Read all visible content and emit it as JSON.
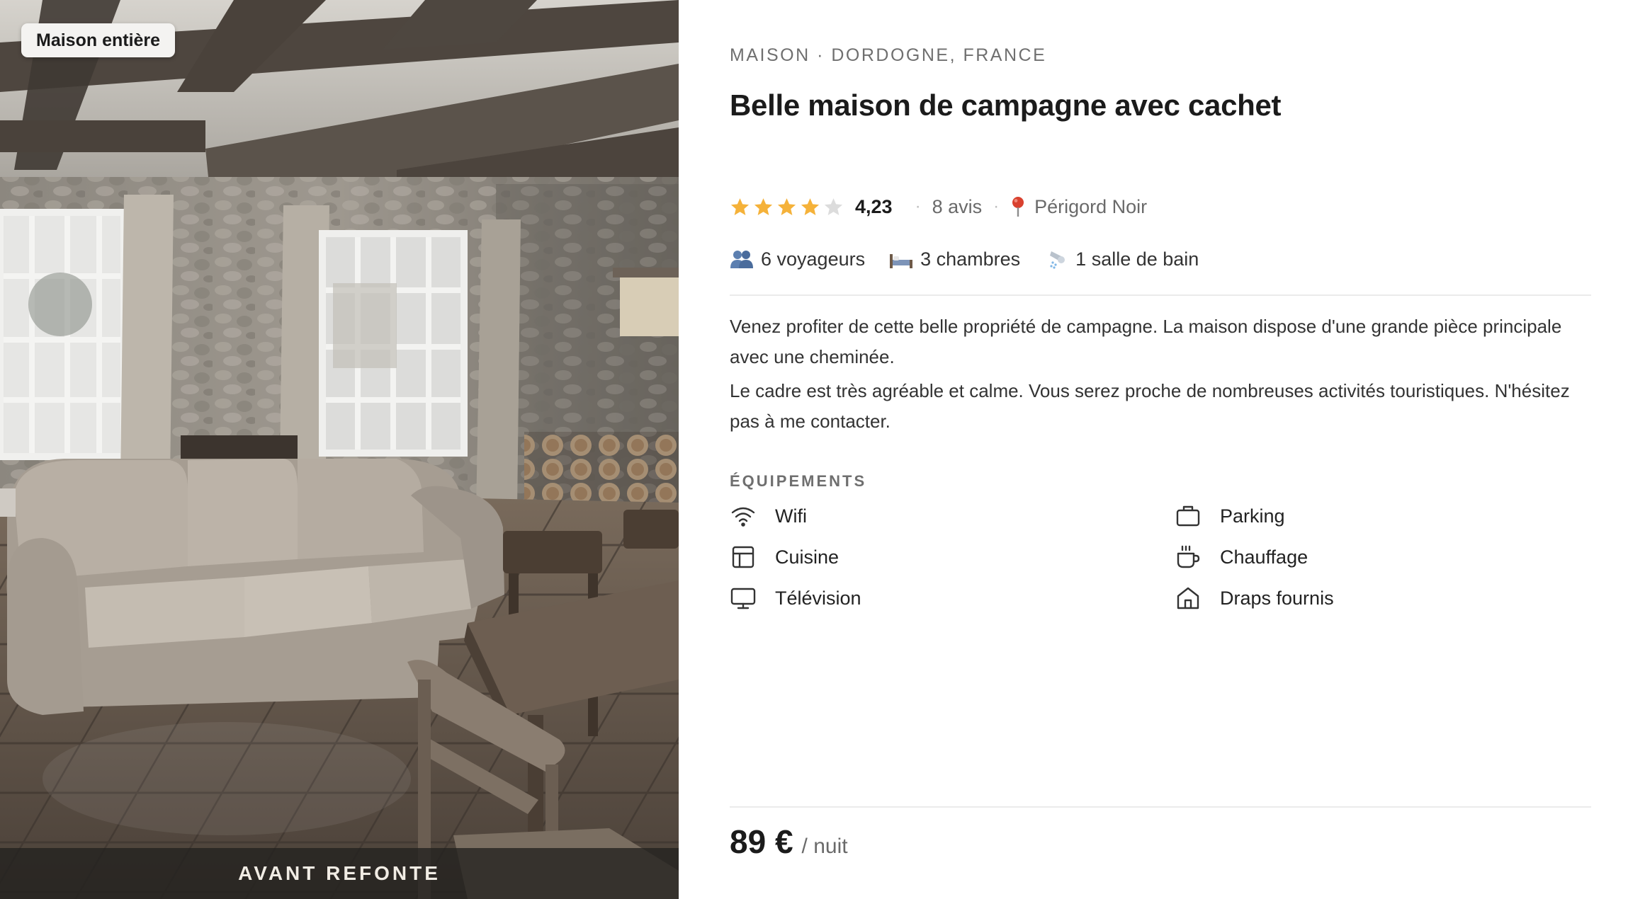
{
  "photo": {
    "badge": "Maison entière",
    "caption": "AVANT REFONTE"
  },
  "listing": {
    "kicker": "MAISON · DORDOGNE, FRANCE",
    "title": "Belle maison de campagne avec cachet",
    "rating": 4.23,
    "rating_label": "4,23",
    "stars_filled": 4,
    "stars_total": 5,
    "reviews": "8 avis",
    "location": "Périgord Noir",
    "facts": [
      {
        "icon": "people-icon",
        "label": "6 voyageurs"
      },
      {
        "icon": "bed-icon",
        "label": "3 chambres"
      },
      {
        "icon": "shower-icon",
        "label": "1 salle de bain"
      }
    ],
    "description": [
      "Venez profiter de cette belle propriété de campagne. La maison dispose d'une grande pièce principale avec une cheminée.",
      "Le cadre est très agréable et calme. Vous serez proche de nombreuses activités touristiques. N'hésitez pas à me contacter."
    ],
    "amenities_title": "ÉQUIPEMENTS",
    "amenities": [
      {
        "icon": "wifi-icon",
        "label": "Wifi"
      },
      {
        "icon": "briefcase-icon",
        "label": "Parking"
      },
      {
        "icon": "kitchen-icon",
        "label": "Cuisine"
      },
      {
        "icon": "cup-icon",
        "label": "Chauffage"
      },
      {
        "icon": "tv-icon",
        "label": "Télévision"
      },
      {
        "icon": "house-icon",
        "label": "Draps fournis"
      }
    ],
    "price": "89 €",
    "price_unit": "/ nuit"
  },
  "colors": {
    "star": "#f5b23a",
    "star_empty": "#dcdcdc",
    "pin": "#d9412f",
    "text": "#1b1b1b",
    "muted": "#6f6f6f"
  }
}
